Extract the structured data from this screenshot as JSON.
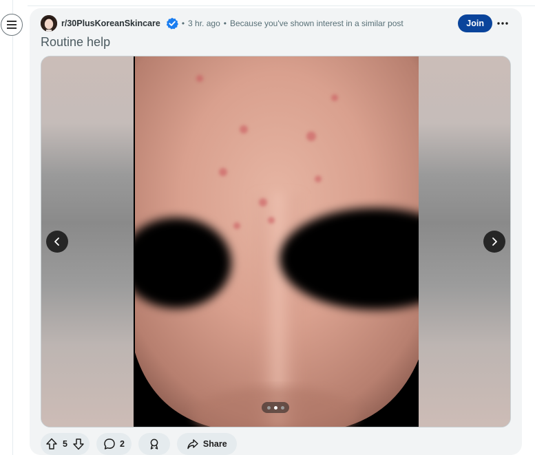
{
  "post": {
    "subreddit": "r/30PlusKoreanSkincare",
    "time": "3 hr. ago",
    "reason": "Because you've shown interest in a similar post",
    "join_label": "Join",
    "title": "Routine help"
  },
  "media": {
    "current_slide": 2,
    "total_slides": 3
  },
  "actions": {
    "votes": "5",
    "comments": "2",
    "share_label": "Share"
  },
  "icons": {
    "rail": "hamburger-menu-icon",
    "verified": "verified-badge-icon",
    "more": "more-horizontal-icon",
    "prev": "chevron-left-icon",
    "next": "chevron-right-icon",
    "upvote": "upvote-arrow-icon",
    "downvote": "downvote-arrow-icon",
    "comment": "comment-bubble-icon",
    "award": "award-icon",
    "share": "share-arrow-icon"
  },
  "colors": {
    "join": "#0a449b",
    "verified": "#1a7df0",
    "card": "#f2f4f5",
    "pill": "#e5ebee"
  }
}
